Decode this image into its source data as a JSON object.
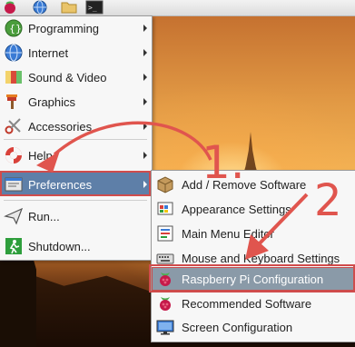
{
  "taskbar": {
    "icons": [
      "raspberry-pi-menu-icon",
      "web-browser-icon",
      "file-manager-icon",
      "terminal-icon"
    ],
    "terminal_glyph": ">_"
  },
  "main_menu": {
    "items": [
      {
        "label": "Programming",
        "icon": "programming-icon",
        "submenu": true
      },
      {
        "label": "Internet",
        "icon": "internet-globe-icon",
        "submenu": true
      },
      {
        "label": "Sound & Video",
        "icon": "sound-video-icon",
        "submenu": true
      },
      {
        "label": "Graphics",
        "icon": "graphics-icon",
        "submenu": true
      },
      {
        "label": "Accessories",
        "icon": "accessories-icon",
        "submenu": true
      },
      {
        "label": "Help",
        "icon": "help-lifebuoy-icon",
        "submenu": true
      },
      {
        "label": "Preferences",
        "icon": "preferences-icon",
        "submenu": true,
        "selected": true
      },
      {
        "label": "Run...",
        "icon": "run-icon",
        "submenu": false
      },
      {
        "label": "Shutdown...",
        "icon": "shutdown-icon",
        "submenu": false
      }
    ]
  },
  "preferences_menu": {
    "items": [
      {
        "label": "Add / Remove Software",
        "icon": "package-icon"
      },
      {
        "label": "Appearance Settings",
        "icon": "appearance-icon"
      },
      {
        "label": "Main Menu Editor",
        "icon": "menu-editor-icon"
      },
      {
        "label": "Mouse and Keyboard Settings",
        "icon": "keyboard-icon"
      },
      {
        "label": "Raspberry Pi Configuration",
        "icon": "raspberry-pi-icon",
        "selected": true
      },
      {
        "label": "Recommended Software",
        "icon": "raspberry-pi-icon"
      },
      {
        "label": "Screen Configuration",
        "icon": "monitor-icon"
      }
    ]
  },
  "annotations": {
    "step1": "1.",
    "step2": "2",
    "color": "#e0554e"
  },
  "colors": {
    "selection_blue": "#5e7fa8",
    "highlight_red": "#d04c4c"
  }
}
